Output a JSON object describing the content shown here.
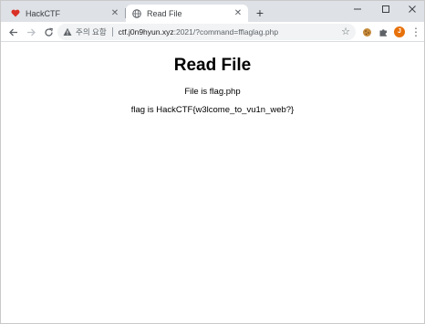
{
  "tabs": [
    {
      "title": "HackCTF",
      "favicon": "heart-icon"
    },
    {
      "title": "Read File",
      "favicon": "globe-icon",
      "active": true
    }
  ],
  "toolbar": {
    "security_warning": "주의 요함",
    "url_host": "ctf.j0n9hyun.xyz",
    "url_rest": ":2021/?command=fflaglag.php"
  },
  "page": {
    "heading": "Read File",
    "file_line": "File is flag.php",
    "flag_line": "flag is HackCTF{w3lcome_to_vu1n_web?}"
  },
  "colors": {
    "tabstrip": "#dee1e6",
    "heart": "#d93025",
    "profile": "#e8710a"
  }
}
